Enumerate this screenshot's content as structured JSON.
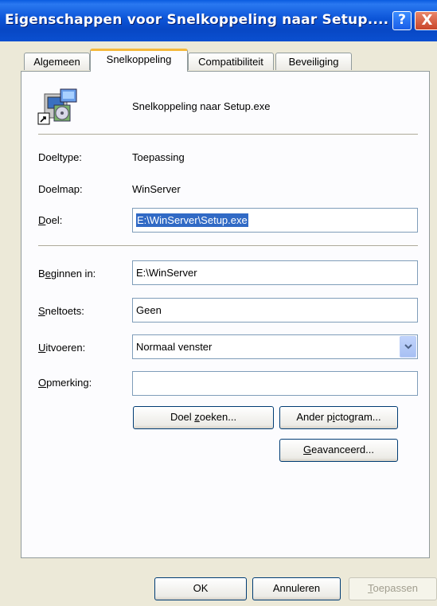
{
  "window": {
    "title": "Eigenschappen voor Snelkoppeling naar Setup....",
    "help_label": "?",
    "close_label": "X"
  },
  "tabs": [
    {
      "label": "Algemeen",
      "active": false
    },
    {
      "label": "Snelkoppeling",
      "active": true
    },
    {
      "label": "Compatibiliteit",
      "active": false
    },
    {
      "label": "Beveiliging",
      "active": false
    }
  ],
  "header": {
    "icon": "setup-shortcut-icon",
    "name": "Snelkoppeling naar Setup.exe"
  },
  "info": {
    "doeltype_label": "Doeltype:",
    "doeltype_value": "Toepassing",
    "doelmap_label": "Doelmap:",
    "doelmap_value": "WinServer"
  },
  "fields": {
    "doel_mnemonic": "D",
    "doel_label_rest": "oel:",
    "doel_value": "E:\\WinServer\\Setup.exe",
    "beginnen_prefix": "B",
    "beginnen_mnemonic": "e",
    "beginnen_rest": "ginnen in:",
    "beginnen_value": "E:\\WinServer",
    "sneltoets_mnemonic": "S",
    "sneltoets_rest": "neltoets:",
    "sneltoets_value": "Geen",
    "uitvoeren_mnemonic": "U",
    "uitvoeren_rest": "itvoeren:",
    "uitvoeren_value": "Normaal venster",
    "opmerking_mnemonic": "O",
    "opmerking_rest": "pmerking:",
    "opmerking_value": ""
  },
  "buttons": {
    "doel_zoeken_prefix": "Doel ",
    "doel_zoeken_mnemonic": "z",
    "doel_zoeken_rest": "oeken...",
    "ander_prefix": "Ander p",
    "ander_mnemonic": "i",
    "ander_rest": "ctogram...",
    "geavanceerd_mnemonic": "G",
    "geavanceerd_rest": "eavanceerd...",
    "ok": "OK",
    "annuleren": "Annuleren",
    "toepassen_mnemonic": "T",
    "toepassen_rest": "oepassen",
    "toepassen_enabled": false
  },
  "colors": {
    "titlebar": "#0a53d6",
    "tab_highlight": "#f5b83b",
    "selection": "#316ac5"
  }
}
